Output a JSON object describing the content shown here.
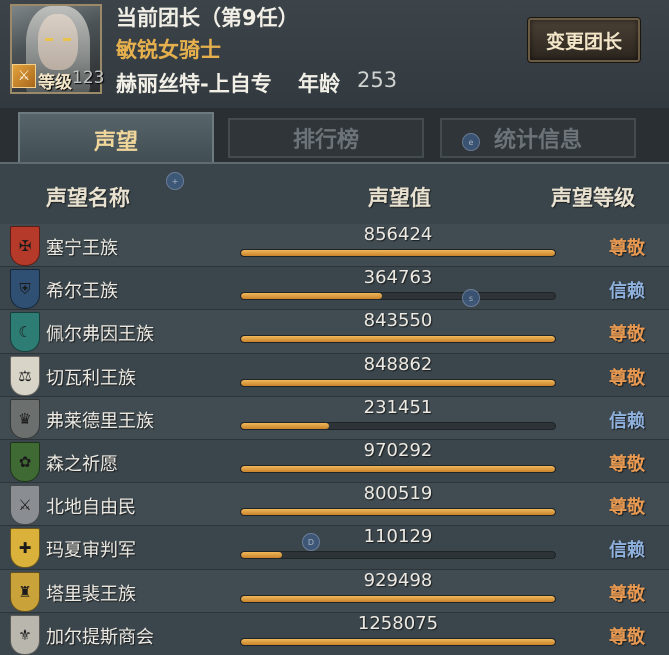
{
  "header": {
    "leader_title": "当前团长（第9任）",
    "leader_class": "敏锐女骑士",
    "leader_name": "赫丽丝特-上自专",
    "age_label": "年龄",
    "age_value": "253",
    "level_label": "等级",
    "level_value": "123",
    "change_button": "变更团长"
  },
  "tabs": [
    {
      "label": "声望",
      "active": true
    },
    {
      "label": "排行榜",
      "active": false
    },
    {
      "label": "统计信息",
      "active": false
    }
  ],
  "table": {
    "headers": {
      "name": "声望名称",
      "value": "声望值",
      "level": "声望等级"
    },
    "rows": [
      {
        "name": "塞宁王族",
        "value": "856424",
        "level": "尊敬",
        "level_type": "revered",
        "progress": 1.0,
        "emblem_color": "#b63a2a",
        "emblem_glyph": "✠"
      },
      {
        "name": "希尔王族",
        "value": "364763",
        "level": "信赖",
        "level_type": "trusted",
        "progress": 0.45,
        "emblem_color": "#2f4f73",
        "emblem_glyph": "⛨"
      },
      {
        "name": "佩尔弗因王族",
        "value": "843550",
        "level": "尊敬",
        "level_type": "revered",
        "progress": 1.0,
        "emblem_color": "#2e7d74",
        "emblem_glyph": "☾"
      },
      {
        "name": "切瓦利王族",
        "value": "848862",
        "level": "尊敬",
        "level_type": "revered",
        "progress": 1.0,
        "emblem_color": "#d8d4c8",
        "emblem_glyph": "⚖"
      },
      {
        "name": "弗莱德里王族",
        "value": "231451",
        "level": "信赖",
        "level_type": "trusted",
        "progress": 0.28,
        "emblem_color": "#6b6f6e",
        "emblem_glyph": "♛"
      },
      {
        "name": "森之祈愿",
        "value": "970292",
        "level": "尊敬",
        "level_type": "revered",
        "progress": 1.0,
        "emblem_color": "#3f6a34",
        "emblem_glyph": "✿"
      },
      {
        "name": "北地自由民",
        "value": "800519",
        "level": "尊敬",
        "level_type": "revered",
        "progress": 1.0,
        "emblem_color": "#8a8e92",
        "emblem_glyph": "⚔"
      },
      {
        "name": "玛夏审判军",
        "value": "110129",
        "level": "信赖",
        "level_type": "trusted",
        "progress": 0.13,
        "emblem_color": "#d9b13b",
        "emblem_glyph": "✚"
      },
      {
        "name": "塔里裴王族",
        "value": "929498",
        "level": "尊敬",
        "level_type": "revered",
        "progress": 1.0,
        "emblem_color": "#c9a23a",
        "emblem_glyph": "♜"
      },
      {
        "name": "加尔提斯商会",
        "value": "1258075",
        "level": "尊敬",
        "level_type": "revered",
        "progress": 1.0,
        "emblem_color": "#b9b6ae",
        "emblem_glyph": "⚜"
      }
    ]
  }
}
